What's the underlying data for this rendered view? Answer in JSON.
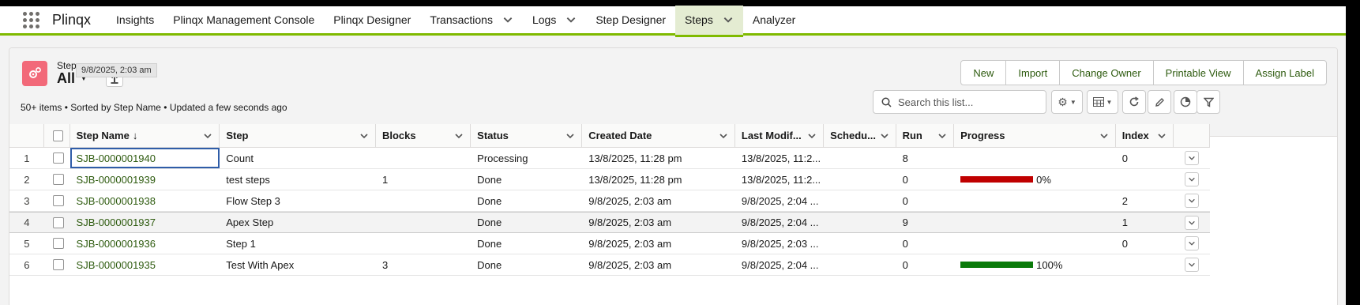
{
  "app": {
    "name": "Plinqx"
  },
  "nav": [
    {
      "label": "Insights",
      "dropdown": false,
      "active": false
    },
    {
      "label": "Plinqx Management Console",
      "dropdown": false,
      "active": false
    },
    {
      "label": "Plinqx Designer",
      "dropdown": false,
      "active": false
    },
    {
      "label": "Transactions",
      "dropdown": true,
      "active": false
    },
    {
      "label": "Logs",
      "dropdown": true,
      "active": false
    },
    {
      "label": "Step Designer",
      "dropdown": false,
      "active": false
    },
    {
      "label": "Steps",
      "dropdown": true,
      "active": true
    },
    {
      "label": "Analyzer",
      "dropdown": false,
      "active": false
    }
  ],
  "list": {
    "object_type": "Steps",
    "view_name": "All",
    "tooltip": "9/8/2025, 2:03 am",
    "meta": "50+ items • Sorted by Step Name • Updated a few seconds ago"
  },
  "actions": [
    "New",
    "Import",
    "Change Owner",
    "Printable View",
    "Assign Label"
  ],
  "search": {
    "placeholder": "Search this list...",
    "value": ""
  },
  "columns": [
    "Step Name",
    "Step",
    "Blocks",
    "Status",
    "Created Date",
    "Last Modif...",
    "Schedu...",
    "Run",
    "Progress",
    "Index"
  ],
  "rows": [
    {
      "num": "1",
      "name": "SJB-0000001940",
      "step": "Count",
      "blocks": "",
      "status": "Processing",
      "created": "13/8/2025, 11:28 pm",
      "modified": "13/8/2025, 11:2...",
      "scheduled": "",
      "run": "8",
      "progress": null,
      "index": "0"
    },
    {
      "num": "2",
      "name": "SJB-0000001939",
      "step": "test steps",
      "blocks": "1",
      "status": "Done",
      "created": "13/8/2025, 11:28 pm",
      "modified": "13/8/2025, 11:2...",
      "scheduled": "",
      "run": "0",
      "progress": {
        "label": "0%",
        "color": "#c00000"
      },
      "index": ""
    },
    {
      "num": "3",
      "name": "SJB-0000001938",
      "step": "Flow Step 3",
      "blocks": "",
      "status": "Done",
      "created": "9/8/2025, 2:03 am",
      "modified": "9/8/2025, 2:04 ...",
      "scheduled": "",
      "run": "0",
      "progress": null,
      "index": "2"
    },
    {
      "num": "4",
      "name": "SJB-0000001937",
      "step": "Apex Step",
      "blocks": "",
      "status": "Done",
      "created": "9/8/2025, 2:03 am",
      "modified": "9/8/2025, 2:04 ...",
      "scheduled": "",
      "run": "9",
      "progress": null,
      "index": "1"
    },
    {
      "num": "5",
      "name": "SJB-0000001936",
      "step": "Step 1",
      "blocks": "",
      "status": "Done",
      "created": "9/8/2025, 2:03 am",
      "modified": "9/8/2025, 2:03 ...",
      "scheduled": "",
      "run": "0",
      "progress": null,
      "index": "0"
    },
    {
      "num": "6",
      "name": "SJB-0000001935",
      "step": "Test With Apex",
      "blocks": "3",
      "status": "Done",
      "created": "9/8/2025, 2:03 am",
      "modified": "9/8/2025, 2:04 ...",
      "scheduled": "",
      "run": "0",
      "progress": {
        "label": "100%",
        "color": "#0a7a0a"
      },
      "index": ""
    }
  ],
  "colors": {
    "accent": "#7fba00",
    "link": "#2e5b0f",
    "object_icon": "#f26979"
  }
}
